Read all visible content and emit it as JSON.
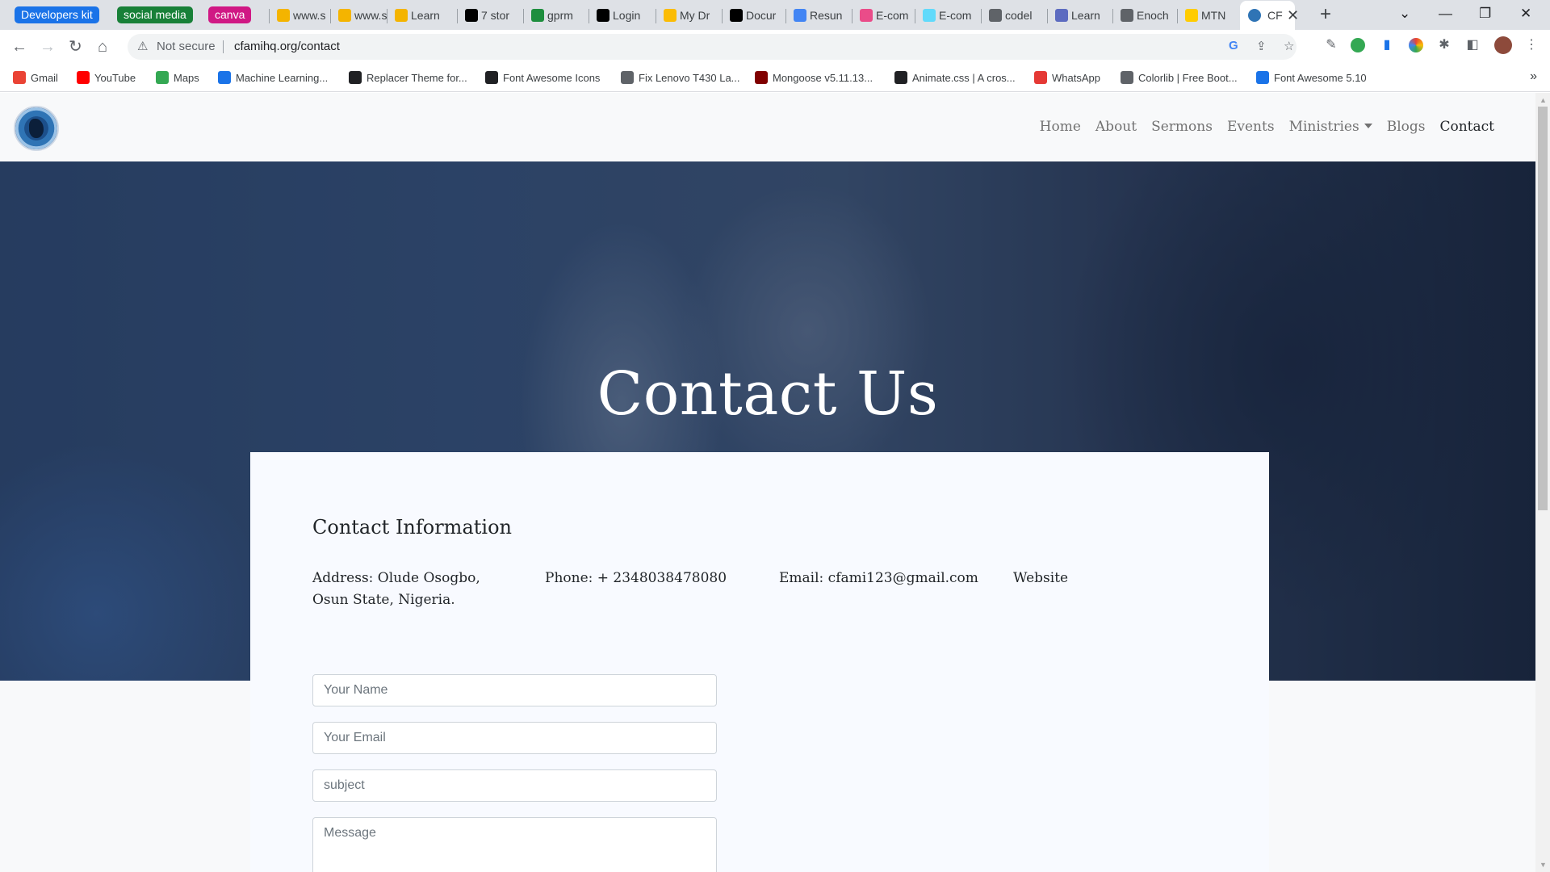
{
  "browser": {
    "tab_groups": [
      {
        "label": "Developers kit",
        "color": "#1a73e8"
      },
      {
        "label": "social media",
        "color": "#188038"
      },
      {
        "label": "canva",
        "color": "#d01884"
      }
    ],
    "tabs": [
      {
        "label": "www.s",
        "icon": "bookmark-icon",
        "color": "#f4b400"
      },
      {
        "label": "www.s",
        "icon": "bookmark-icon",
        "color": "#f4b400"
      },
      {
        "label": "Learn",
        "icon": "bookmark-icon",
        "color": "#f4b400"
      },
      {
        "label": "7 stor",
        "icon": "medium-icon",
        "color": "#000000"
      },
      {
        "label": "gprm",
        "icon": "gmail-icon",
        "color": "#1e8e3e"
      },
      {
        "label": "Login",
        "icon": "chat-icon",
        "color": "#000000"
      },
      {
        "label": "My Dr",
        "icon": "drive-icon",
        "color": "#fbbc04"
      },
      {
        "label": "Docur",
        "icon": "docs-icon",
        "color": "#000000"
      },
      {
        "label": "Resun",
        "icon": "docs-icon",
        "color": "#4285f4"
      },
      {
        "label": "E-com",
        "icon": "dribbble-icon",
        "color": "#ea4c89"
      },
      {
        "label": "E-com",
        "icon": "react-icon",
        "color": "#61dafb"
      },
      {
        "label": "codel",
        "icon": "globe-icon",
        "color": "#5f6368"
      },
      {
        "label": "Learn",
        "icon": "code-icon",
        "color": "#5c6bc0"
      },
      {
        "label": "Enoch",
        "icon": "globe-icon",
        "color": "#5f6368"
      },
      {
        "label": "MTN",
        "icon": "mtn-icon",
        "color": "#ffcc00"
      }
    ],
    "active_tab": {
      "label": "CF",
      "icon": "site-logo-icon"
    },
    "new_tab_symbol": "+",
    "window_controls": {
      "menu": "⌄",
      "minimize": "—",
      "restore": "❐",
      "close": "✕"
    },
    "address_bar": {
      "warning": "Not secure",
      "url": "cfamihq.org/contact"
    },
    "bookmarks": [
      {
        "label": "Gmail",
        "icon": "gmail-icon",
        "color": "#ea4335"
      },
      {
        "label": "YouTube",
        "icon": "youtube-icon",
        "color": "#ff0000"
      },
      {
        "label": "Maps",
        "icon": "maps-icon",
        "color": "#34a853"
      },
      {
        "label": "Machine Learning...",
        "icon": "s-icon",
        "color": "#1a73e8"
      },
      {
        "label": "Replacer Theme for...",
        "icon": "cursor-icon",
        "color": "#202124"
      },
      {
        "label": "Font Awesome Icons",
        "icon": "flag-icon",
        "color": "#202124"
      },
      {
        "label": "Fix Lenovo T430 La...",
        "icon": "globe-icon",
        "color": "#5f6368"
      },
      {
        "label": "Mongoose v5.11.13...",
        "icon": "mongoose-icon",
        "color": "#800000"
      },
      {
        "label": "Animate.css | A cros...",
        "icon": "diamond-icon",
        "color": "#202124"
      },
      {
        "label": "WhatsApp",
        "icon": "whatsapp-icon",
        "color": "#e53935"
      },
      {
        "label": "Colorlib | Free Boot...",
        "icon": "wordpress-icon",
        "color": "#5f6368"
      },
      {
        "label": "Font Awesome 5.10",
        "icon": "flag-icon",
        "color": "#1a73e8"
      }
    ],
    "bookmarks_more": "»"
  },
  "site": {
    "nav": {
      "links": [
        {
          "label": "Home",
          "active": false
        },
        {
          "label": "About",
          "active": false
        },
        {
          "label": "Sermons",
          "active": false
        },
        {
          "label": "Events",
          "active": false
        },
        {
          "label": "Ministries",
          "active": false,
          "dropdown": true
        },
        {
          "label": "Blogs",
          "active": false
        },
        {
          "label": "Contact",
          "active": true
        }
      ]
    },
    "hero": {
      "title": "Contact Us"
    },
    "contact": {
      "heading": "Contact Information",
      "address": "Address: Olude Osogbo, Osun State, Nigeria.",
      "phone": "Phone: + 2348038478080",
      "email": "Email: cfami123@gmail.com",
      "website": "Website"
    },
    "form": {
      "name_placeholder": "Your Name",
      "email_placeholder": "Your Email",
      "subject_placeholder": "subject",
      "message_placeholder": "Message"
    }
  },
  "colors": {
    "page_bg": "#f8f9fa",
    "card_bg": "#f8faff",
    "nav_text": "#727272",
    "nav_active": "#212529",
    "hero_overlay": "#1e375f"
  }
}
